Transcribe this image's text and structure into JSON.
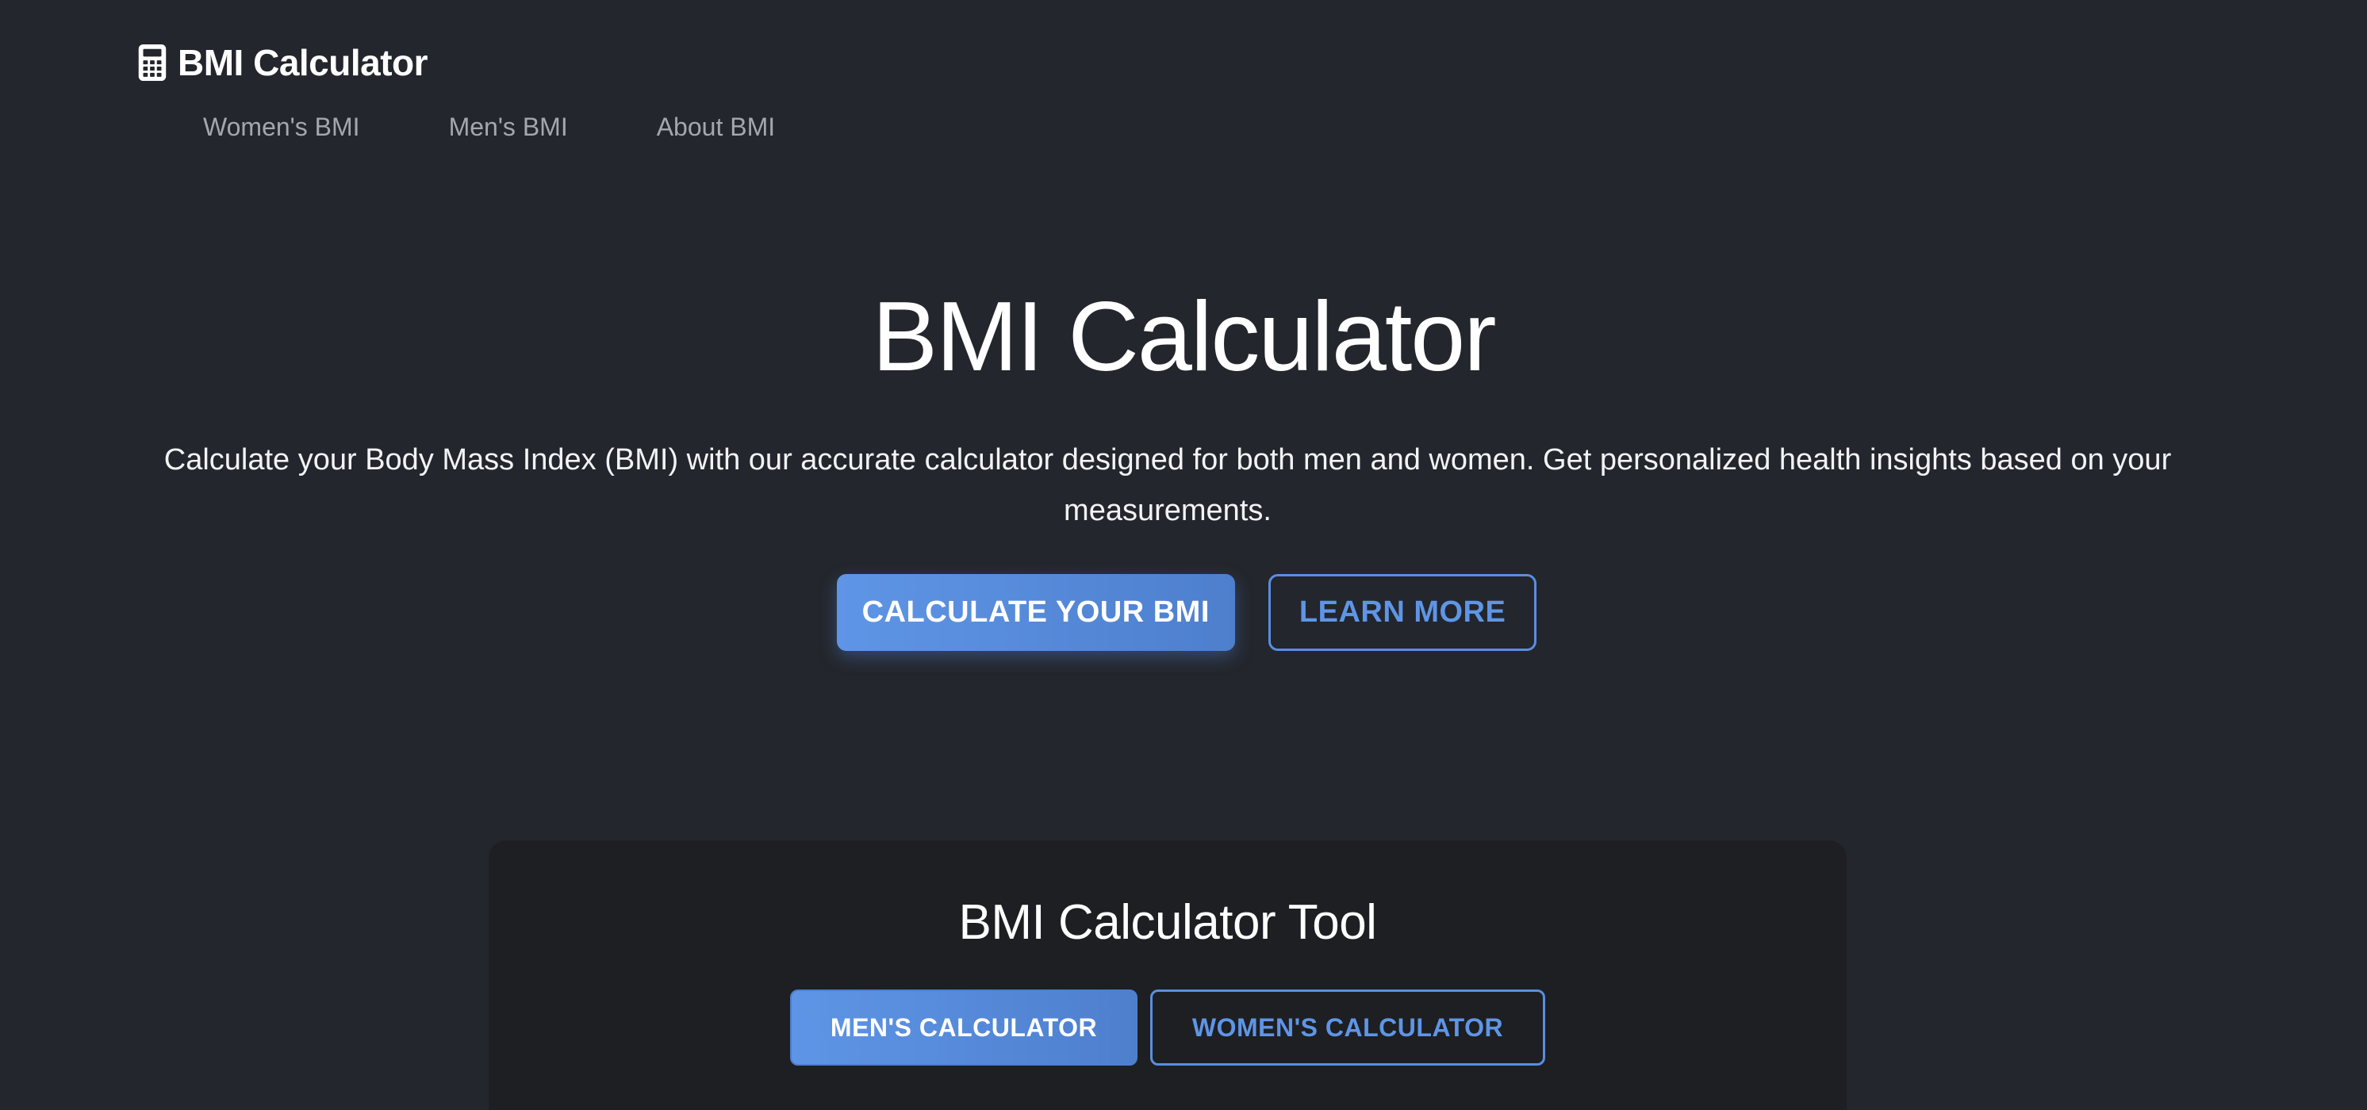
{
  "header": {
    "brand_icon": "calculator-icon",
    "brand_text": "BMI Calculator",
    "nav": [
      {
        "label": "Women's BMI"
      },
      {
        "label": "Men's BMI"
      },
      {
        "label": "About BMI"
      }
    ]
  },
  "hero": {
    "title": "BMI Calculator",
    "subtitle": "Calculate your Body Mass Index (BMI) with our accurate calculator designed for both men and women. Get personalized health insights based on your measurements.",
    "primary_button": "CALCULATE YOUR BMI",
    "secondary_button": "LEARN MORE"
  },
  "tool": {
    "title": "BMI Calculator Tool",
    "tabs": [
      {
        "label": "MEN'S CALCULATOR",
        "active": true
      },
      {
        "label": "WOMEN'S CALCULATOR",
        "active": false
      }
    ]
  },
  "colors": {
    "background": "#23262c",
    "card_background": "#1d1f23",
    "accent": "#5f95e6",
    "nav_text": "#a4a7ad"
  }
}
